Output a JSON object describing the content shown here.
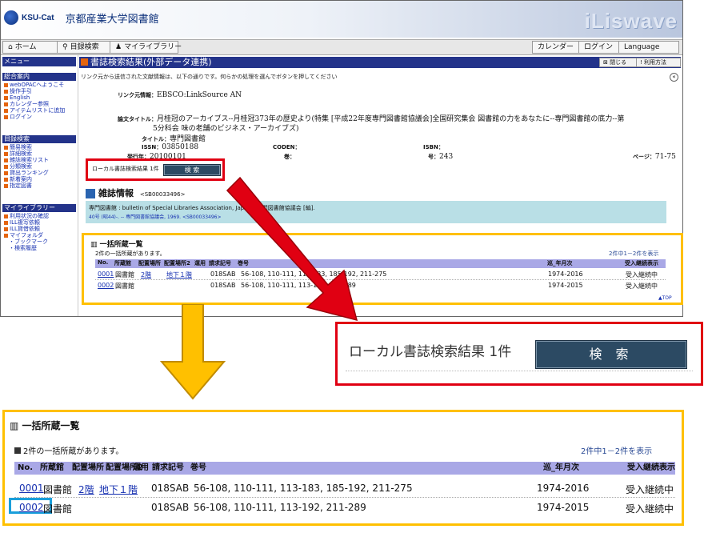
{
  "header": {
    "logo_text": "KSU-Cat",
    "library_name": "京都産業大学図書館",
    "brand": "iLiswave"
  },
  "nav": {
    "home": "ホーム",
    "catalog_search": "目録検索",
    "my_library": "マイライブラリー",
    "calendar": "カレンダー",
    "login": "ログイン",
    "language": "Language"
  },
  "sidebar": {
    "menu_title": "メニュー",
    "sections": [
      {
        "title": "総合案内",
        "items": [
          "webOPACへようこそ",
          "操作手引",
          "English",
          "カレンダー参照",
          "アイテムリストに追加",
          "ログイン"
        ]
      },
      {
        "title": "目録検索",
        "items": [
          "簡易検索",
          "詳細検索",
          "雑誌検索リスト",
          "分類検索",
          "貸出ランキング",
          "新着案内",
          "指定図書"
        ]
      },
      {
        "title": "マイライブラリー",
        "items": [
          "利用状況の確認",
          "ILL複写依頼",
          "ILL貸借依頼",
          "マイフォルダ",
          "・ブックマーク",
          "・検索履歴"
        ]
      }
    ]
  },
  "page": {
    "title": "書誌検索結果(外部データ連携)",
    "close_button": "閉じる",
    "help_button": "利用方法",
    "instruction": "リンク元から送信された文献情報は、以下の通りです。何らかの処理を選んでボタンを押してください"
  },
  "record": {
    "link_source_label": "リンク元情報：",
    "link_source_value": "EBSCO:LinkSource AN",
    "article_title_label": "論文タイトル：",
    "article_title_line1": "月桂冠のアーカイブス--月桂冠373年の歴史より(特集 [平成22年度専門図書館協議会]全国研究集会 図書館の力をあなたに--専門図書館の底力--第",
    "article_title_line2": "5分科会 味の老舗のビジネス・アーカイブズ)",
    "journal_title_label": "タイトル：",
    "journal_title_value": "専門図書館",
    "issn_label": "ISSN：",
    "issn_value": "03850188",
    "coden_label": "CODEN：",
    "isbn_label": "ISBN：",
    "date_label": "発行年：",
    "date_value": "20100101",
    "volume_label": "巻：",
    "issue_label": "号：",
    "issue_value": "243",
    "pages_label": "ページ：",
    "pages_value": "71-75"
  },
  "local": {
    "result_text": "ローカル書誌検索結果 1件",
    "search_button": "検 索"
  },
  "journal_info": {
    "heading": "雑誌情報",
    "code": "<SB00033496>",
    "line1": "専門図書館 : bulletin of Special Libraries Association, Japan / 専門図書館協議会 [編].",
    "line2": "40号 (昭44)-. -- 専門図書館協議会, 1969. <SB00033496>"
  },
  "holdings": {
    "title": "一括所蔵一覧",
    "note": "2件の一括所蔵があります。",
    "count": "2件中1－2件を表示",
    "columns": [
      "No.",
      "所蔵館",
      "配置場所",
      "配置場所2",
      "運用",
      "請求記号",
      "巻号",
      "巡_年月次",
      "受入継続表示"
    ],
    "rows": [
      {
        "no": "0001",
        "library": "図書館",
        "location": "2階",
        "location2": "地下１階",
        "callno": "018SAB",
        "volumes": "56-108, 110-111, 113-183, 185-192, 211-275",
        "years": "1974-2016",
        "status": "受入継続中"
      },
      {
        "no": "0002",
        "library": "図書館",
        "location": "",
        "location2": "",
        "callno": "018SAB",
        "volumes": "56-108, 110-111, 113-192, 211-289",
        "years": "1974-2015",
        "status": "受入継続中"
      }
    ],
    "top_link": "▲TOP"
  },
  "colors": {
    "accent_red": "#e00012",
    "accent_yellow": "#ffc000",
    "highlight_blue": "#1a9fdb",
    "nav_blue": "#23338a",
    "table_header": "#a9a8e6"
  }
}
